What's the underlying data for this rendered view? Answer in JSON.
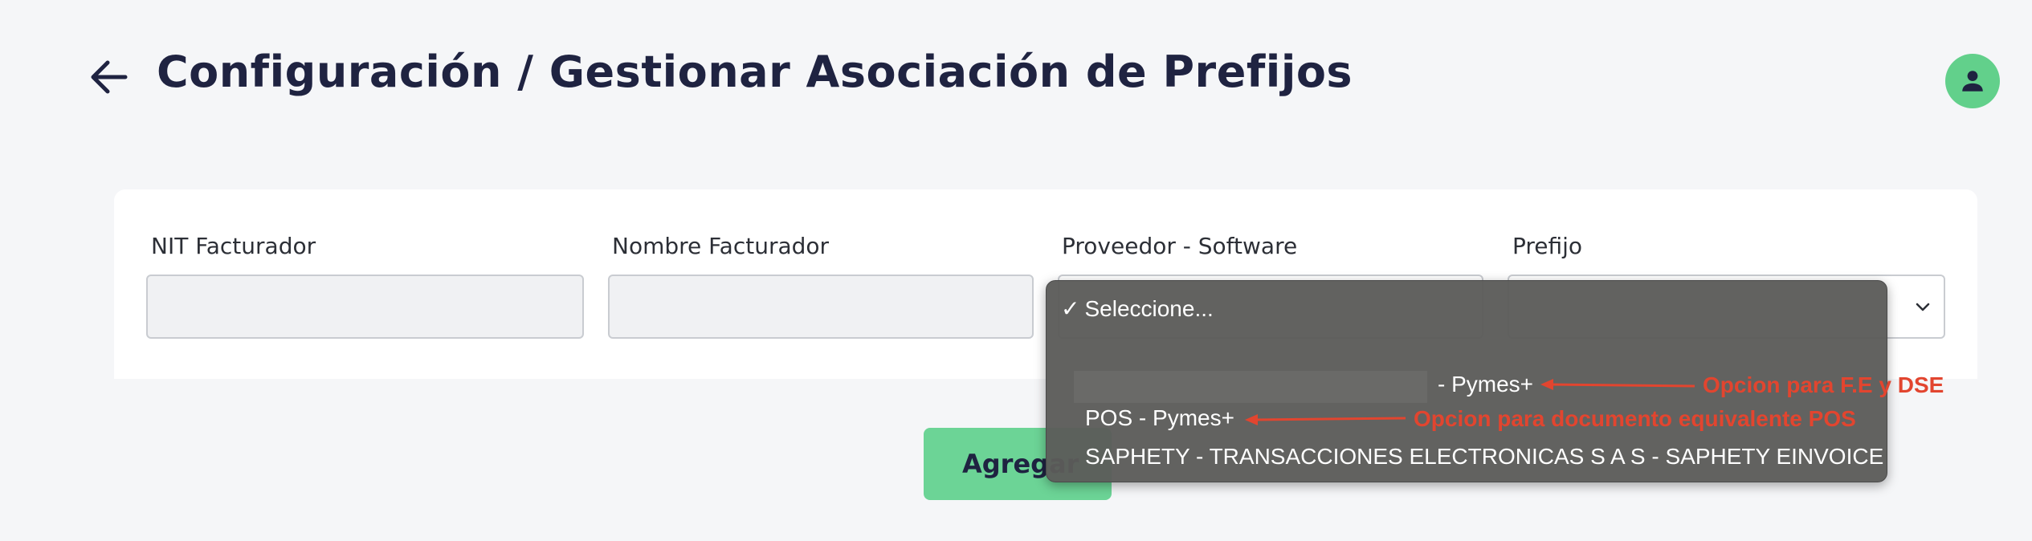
{
  "header": {
    "title": "Configuración / Gestionar Asociación de Prefijos",
    "back_icon": "arrow-left-icon",
    "avatar_icon": "user-icon"
  },
  "form": {
    "nit_label": "NIT Facturador",
    "nit_value": "",
    "nombre_label": "Nombre Facturador",
    "nombre_value": "",
    "proveedor_label": "Proveedor - Software",
    "prefijo_label": "Prefijo",
    "prefijo_value": ""
  },
  "dropdown": {
    "options": [
      {
        "label": "Seleccione...",
        "selected": true
      },
      {
        "label": "- Pymes+"
      },
      {
        "label": "POS - Pymes+"
      },
      {
        "label": "SAPHETY - TRANSACCIONES ELECTRONICAS S A S - SAPHETY EINVOICE"
      }
    ],
    "checkmark": "✓"
  },
  "annotations": {
    "fe_dse": "Opcion para F.E y DSE",
    "pos": "Opcion para documento equivalente POS"
  },
  "buttons": {
    "add_label": "Agregar"
  },
  "colors": {
    "accent_green": "#62d08b",
    "title_navy": "#1f2341",
    "annotation_red": "#e2452f"
  }
}
